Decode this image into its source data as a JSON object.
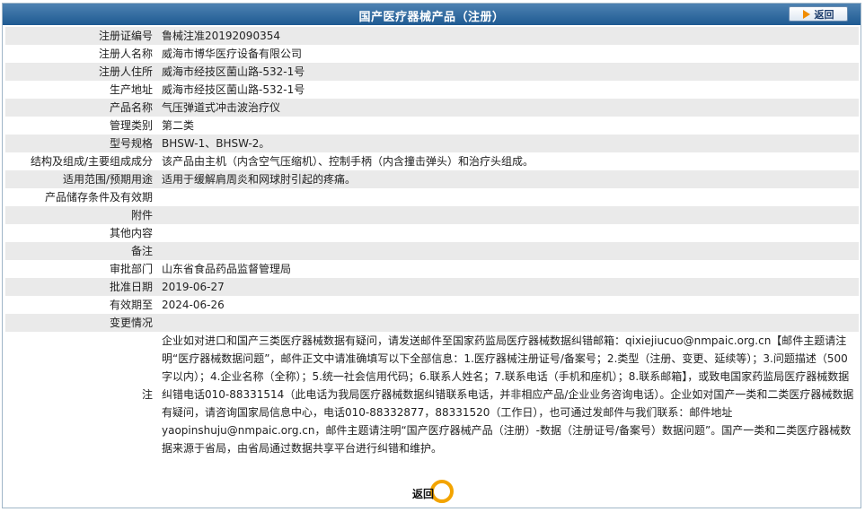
{
  "header": {
    "title": "国产医疗器械产品（注册）",
    "back_label": "返回"
  },
  "rows": [
    {
      "label": "注册证编号",
      "value": "鲁械注准20192090354"
    },
    {
      "label": "注册人名称",
      "value": "威海市博华医疗设备有限公司"
    },
    {
      "label": "注册人住所",
      "value": "威海市经技区菌山路-532-1号"
    },
    {
      "label": "生产地址",
      "value": "威海市经技区菌山路-532-1号"
    },
    {
      "label": "产品名称",
      "value": "气压弹道式冲击波治疗仪"
    },
    {
      "label": "管理类别",
      "value": "第二类"
    },
    {
      "label": "型号规格",
      "value": "BHSW-1、BHSW-2。"
    },
    {
      "label": "结构及组成/主要组成成分",
      "value": "该产品由主机（内含空气压缩机）、控制手柄（内含撞击弹头）和治疗头组成。"
    },
    {
      "label": "适用范围/预期用途",
      "value": "适用于缓解肩周炎和网球肘引起的疼痛。"
    },
    {
      "label": "产品储存条件及有效期",
      "value": ""
    },
    {
      "label": "附件",
      "value": ""
    },
    {
      "label": "其他内容",
      "value": ""
    },
    {
      "label": "备注",
      "value": ""
    },
    {
      "label": "审批部门",
      "value": "山东省食品药品监督管理局"
    },
    {
      "label": "批准日期",
      "value": "2019-06-27"
    },
    {
      "label": "有效期至",
      "value": "2024-06-26"
    },
    {
      "label": "变更情况",
      "value": ""
    }
  ],
  "note": {
    "label": "注",
    "text": "企业如对进口和国产三类医疗器械数据有疑问，请发送邮件至国家药监局医疗器械数据纠错邮箱：qixiejiucuo@nmpaic.org.cn【邮件主题请注明“医疗器械数据问题”，邮件正文中请准确填写以下全部信息：1.医疗器械注册证号/备案号；2.类型（注册、变更、延续等）；3.问题描述（500字以内）；4.企业名称（全称）；5.统一社会信用代码；6.联系人姓名；7.联系电话（手机和座机）；8.联系邮箱】，或致电国家药监局医疗器械数据纠错电话010-88331514（此电话为我局医疗器械数据纠错联系电话，并非相应产品/企业业务咨询电话）。企业如对国产一类和二类医疗器械数据有疑问，请咨询国家局信息中心，电话010-88332877，88331520（工作日），也可通过发邮件与我们联系：邮件地址yaopinshuju@nmpaic.org.cn，邮件主题请注明“国产医疗器械产品（注册）-数据（注册证号/备案号）数据问题”。国产一类和二类医疗器械数据来源于省局，由省局通过数据共享平台进行纠错和维护。"
  },
  "footer": {
    "back_label": "返回"
  },
  "colors": {
    "header_bg": "#1e5a92",
    "row_shade": "#eaeaea",
    "accent": "#f3a400"
  }
}
